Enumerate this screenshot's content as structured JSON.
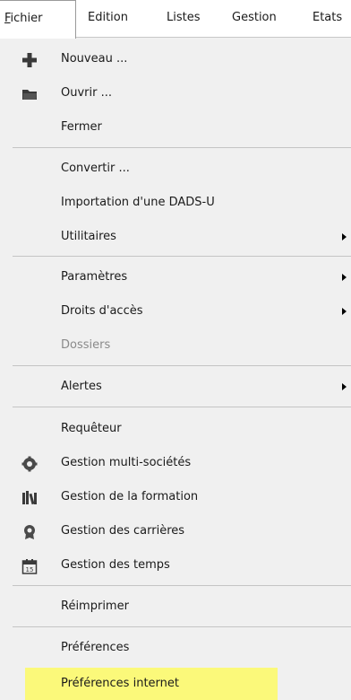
{
  "menubar": {
    "items": [
      {
        "label": "Fichier"
      },
      {
        "label": "Edition"
      },
      {
        "label": "Listes"
      },
      {
        "label": "Gestion"
      },
      {
        "label": "Etats"
      }
    ]
  },
  "menu": {
    "items": [
      {
        "label": "Nouveau ...",
        "icon": "plus-icon"
      },
      {
        "label": "Ouvrir ...",
        "icon": "folder-icon"
      },
      {
        "label": "Fermer"
      },
      {
        "label": "Convertir ..."
      },
      {
        "label": "Importation d'une DADS-U"
      },
      {
        "label": "Utilitaires",
        "submenu": true
      },
      {
        "label": "Paramètres",
        "submenu": true
      },
      {
        "label": "Droits d'accès",
        "submenu": true
      },
      {
        "label": "Dossiers",
        "disabled": true
      },
      {
        "label": "Alertes",
        "submenu": true
      },
      {
        "label": "Requêteur"
      },
      {
        "label": "Gestion multi-sociétés",
        "icon": "gear-icon"
      },
      {
        "label": "Gestion de la formation",
        "icon": "books-icon"
      },
      {
        "label": "Gestion des carrières",
        "icon": "badge-icon"
      },
      {
        "label": "Gestion des temps",
        "icon": "calendar-icon"
      },
      {
        "label": "Réimprimer"
      },
      {
        "label": "Préférences"
      },
      {
        "label": "Préférences internet",
        "highlighted": true,
        "highlight_color": "#fbf97a"
      }
    ]
  }
}
